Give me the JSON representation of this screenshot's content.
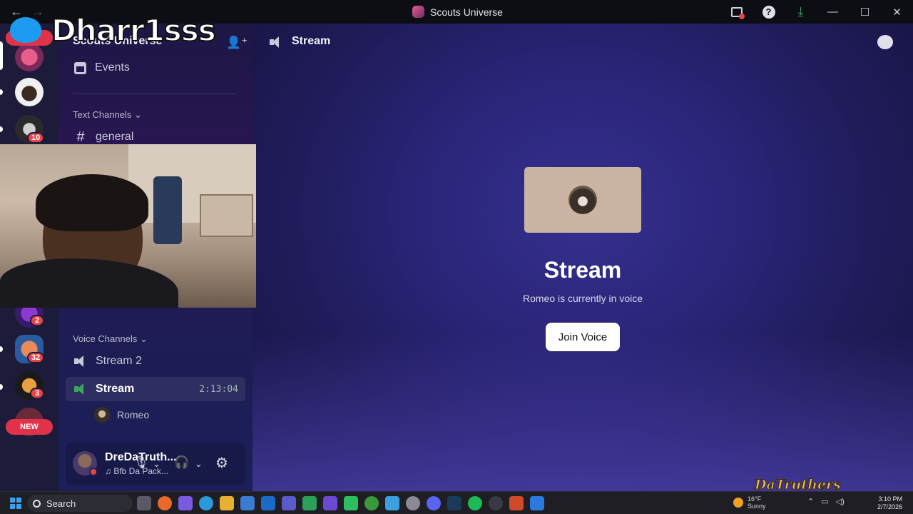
{
  "window": {
    "title": "Scouts Universe"
  },
  "nav": {
    "back": "←",
    "forward": "→"
  },
  "server": {
    "name": "Scouts Universe"
  },
  "sidebar": {
    "events_label": "Events",
    "text_category": "Text Channels",
    "text_channels": [
      {
        "name": "general"
      }
    ],
    "voice_category": "Voice Channels",
    "voice_channels": [
      {
        "name": "Stream 2"
      },
      {
        "name": "Stream",
        "timer": "2:13:04",
        "active": true
      }
    ],
    "voice_members": [
      {
        "name": "Romeo"
      }
    ]
  },
  "rail": {
    "badges": [
      "10",
      "2",
      "32",
      "3"
    ],
    "new_label": "NEW"
  },
  "user_panel": {
    "name": "DreDaTruth...",
    "status": "♫ Bfb Da Pack..."
  },
  "main": {
    "channel_title": "Stream",
    "vc_title": "Stream",
    "vc_subtitle": "Romeo is currently in voice",
    "join_button": "Join Voice"
  },
  "overlay": {
    "streamer_name": "Dharr1sss",
    "watermark": "DaTruthers",
    "new_label": "NEW"
  },
  "taskbar": {
    "search_placeholder": "Search",
    "weather_temp": "16°F",
    "weather_cond": "Sunny",
    "time": "3:10 PM",
    "date": "2/7/2026"
  },
  "colors": {
    "accent_red": "#ed4245",
    "voice_green": "#3ba55d",
    "main_bg": "#2a2578"
  }
}
